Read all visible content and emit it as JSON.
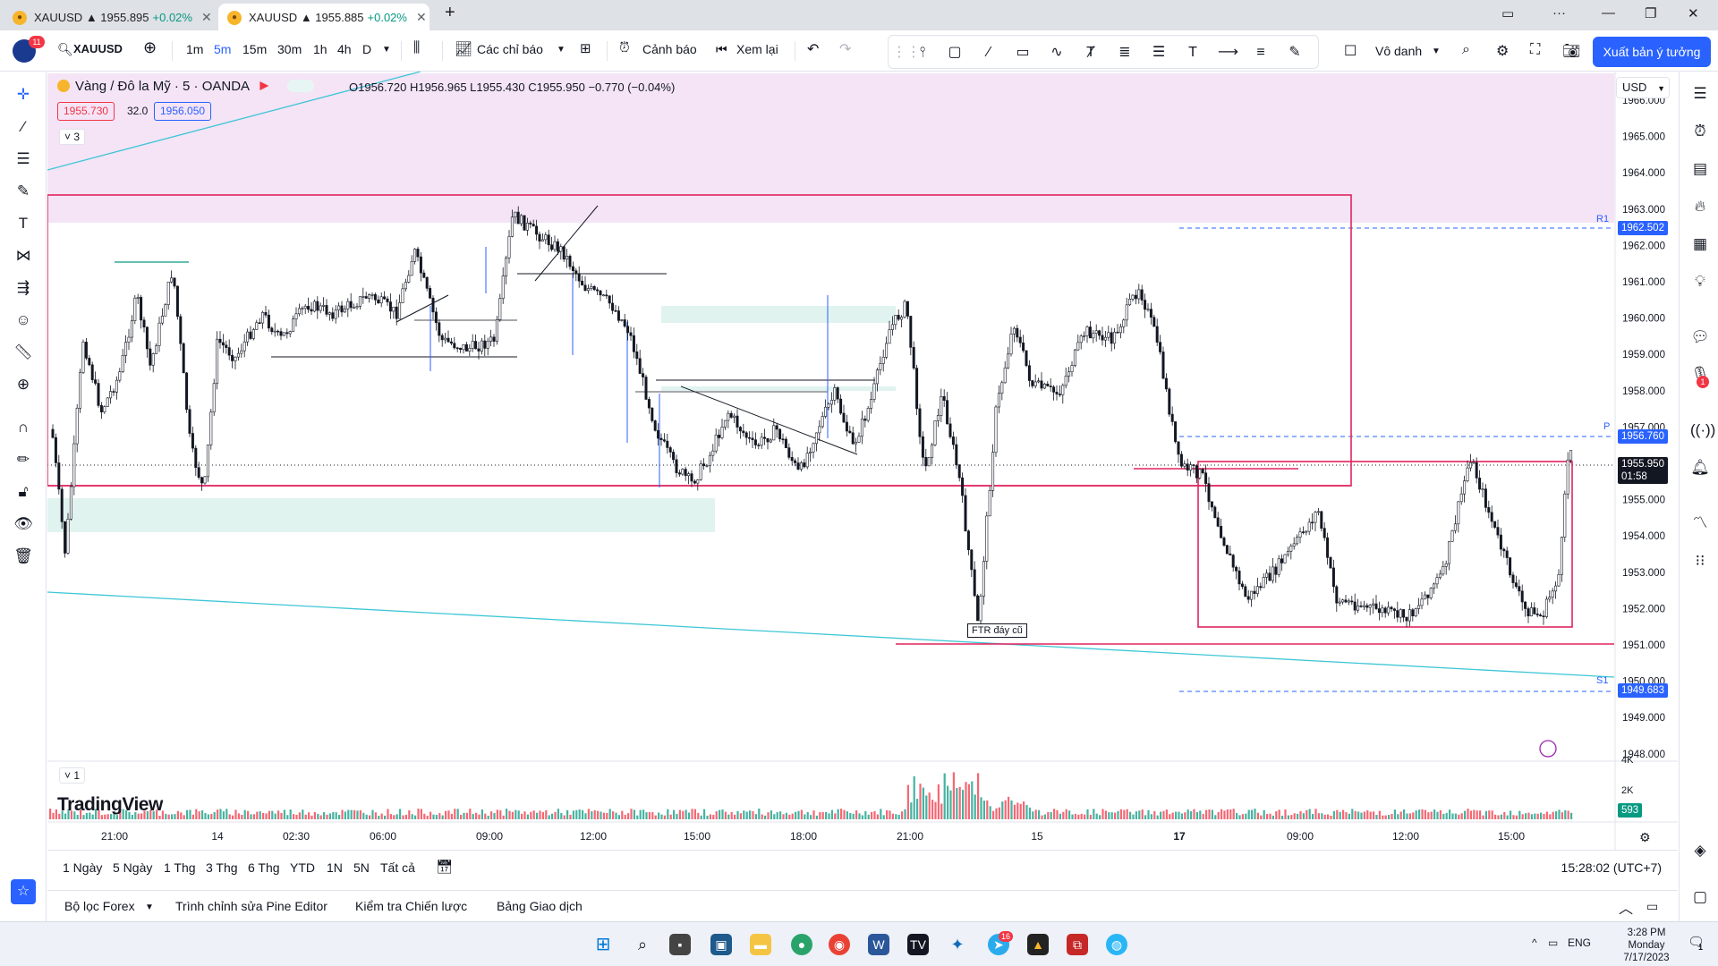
{
  "browser": {
    "tabs": [
      {
        "title": "XAUUSD",
        "price": "▲ 1955.895",
        "change": "+0.02%"
      },
      {
        "title": "XAUUSD",
        "price": "▲ 1955.885",
        "change": "+0.02%"
      }
    ]
  },
  "toolbar": {
    "logo_badge": "11",
    "symbol": "XAUUSD",
    "intervals": [
      "1m",
      "5m",
      "15m",
      "30m",
      "1h",
      "4h",
      "D"
    ],
    "selected_interval": "5m",
    "indicators_label": "Các chỉ báo",
    "alert_label": "Cảnh báo",
    "replay_label": "Xem lại",
    "layout_name": "Vô danh",
    "publish_label": "Xuất bản ý tưởng"
  },
  "legend": {
    "title": "Vàng / Đô la Mỹ · 5 · OANDA",
    "ohlc": "O1956.720 H1956.965 L1955.430 C1955.950 −0.770 (−0.04%)",
    "bid": "1955.730",
    "spread": "32.0",
    "ask": "1956.050",
    "collapse_count": "3"
  },
  "currency": "USD",
  "price_axis": {
    "labels": [
      "1966.000",
      "1965.000",
      "1964.000",
      "1963.000",
      "1962.000",
      "1961.000",
      "1960.000",
      "1959.000",
      "1958.000",
      "1957.000",
      "1956.000",
      "1955.000",
      "1954.000",
      "1953.000",
      "1952.000",
      "1951.000",
      "1950.000",
      "1949.000",
      "1948.000"
    ],
    "r1_label": "R1",
    "r1_value": "1962.502",
    "p_label": "P",
    "p_value": "1956.760",
    "last_price": "1955.950",
    "countdown": "01:58",
    "s1_label": "S1",
    "s1_value": "1949.683",
    "volume_labels": [
      "4K",
      "2K"
    ],
    "volume_value": "593"
  },
  "time_axis": [
    "21:00",
    "14",
    "02:30",
    "06:00",
    "09:00",
    "12:00",
    "15:00",
    "18:00",
    "21:00",
    "15",
    "17",
    "09:00",
    "12:00",
    "15:00"
  ],
  "annotation": "FTR đáy cũ",
  "volume_pane": {
    "collapse_count": "1",
    "brand": "TradingView"
  },
  "ranges": [
    "1 Ngày",
    "5 Ngày",
    "1 Thg",
    "3 Thg",
    "6 Thg",
    "YTD",
    "1N",
    "5N",
    "Tất cả"
  ],
  "clock": "15:28:02 (UTC+7)",
  "panels": [
    "Bộ lọc Forex",
    "Trình chỉnh sửa Pine Editor",
    "Kiểm tra Chiến lược",
    "Bảng Giao dịch"
  ],
  "taskbar": {
    "lang": "ENG",
    "time": "3:28 PM",
    "day": "Monday",
    "date": "7/17/2023",
    "telegram_badge": "16",
    "notif_count": "1"
  },
  "right_badge": "1",
  "colors": {
    "up": "#089981",
    "down": "#f23645",
    "accent": "#2962ff",
    "zone_pink": "#f4e4f6",
    "zone_green": "#e0f3ef",
    "rect": "#e0245e",
    "trend": "#3ec6d6"
  }
}
